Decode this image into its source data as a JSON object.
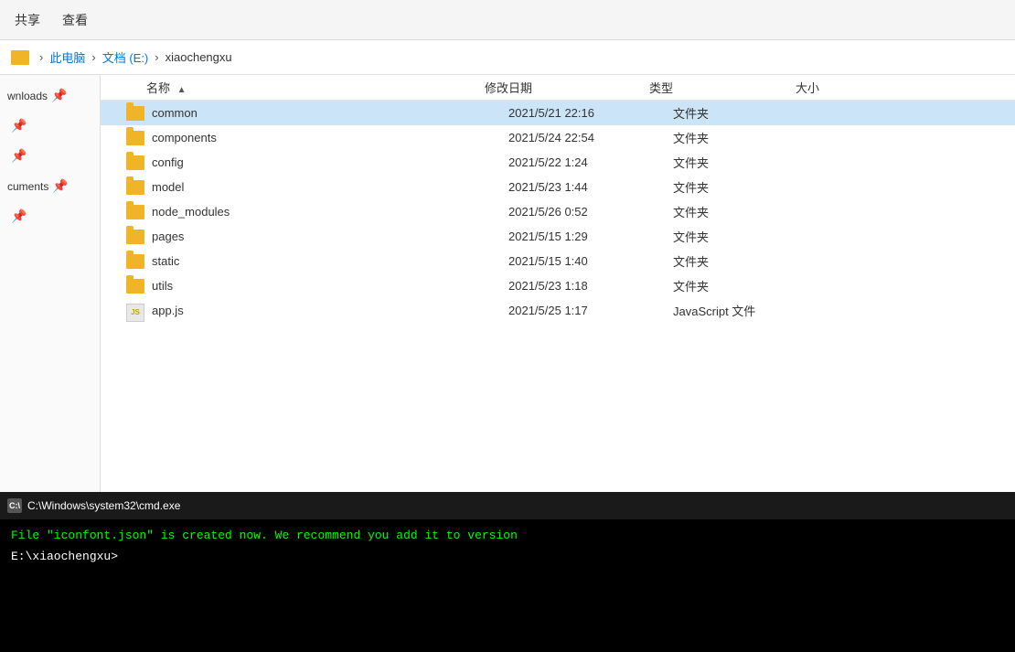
{
  "toolbar": {
    "items": [
      "共享",
      "查看"
    ]
  },
  "breadcrumb": {
    "icon_label": "folder",
    "path": [
      {
        "label": "此电脑",
        "sep": "›"
      },
      {
        "label": "文档 (E:)",
        "sep": "›"
      },
      {
        "label": "xiaochengxu",
        "sep": ""
      }
    ]
  },
  "sidebar": {
    "items": [
      {
        "label": "wnloads",
        "pin": true
      },
      {
        "label": "",
        "pin": true
      },
      {
        "label": "",
        "pin": true
      },
      {
        "label": "cuments",
        "pin": true
      },
      {
        "label": "",
        "pin": true
      }
    ]
  },
  "columns": {
    "name": "名称",
    "date": "修改日期",
    "type": "类型",
    "size": "大小"
  },
  "files": [
    {
      "name": "common",
      "date": "2021/5/21 22:16",
      "type": "文件夹",
      "size": "",
      "kind": "folder",
      "selected": true
    },
    {
      "name": "components",
      "date": "2021/5/24 22:54",
      "type": "文件夹",
      "size": "",
      "kind": "folder",
      "selected": false
    },
    {
      "name": "config",
      "date": "2021/5/22 1:24",
      "type": "文件夹",
      "size": "",
      "kind": "folder",
      "selected": false
    },
    {
      "name": "model",
      "date": "2021/5/23 1:44",
      "type": "文件夹",
      "size": "",
      "kind": "folder",
      "selected": false
    },
    {
      "name": "node_modules",
      "date": "2021/5/26 0:52",
      "type": "文件夹",
      "size": "",
      "kind": "folder",
      "selected": false
    },
    {
      "name": "pages",
      "date": "2021/5/15 1:29",
      "type": "文件夹",
      "size": "",
      "kind": "folder",
      "selected": false
    },
    {
      "name": "static",
      "date": "2021/5/15 1:40",
      "type": "文件夹",
      "size": "",
      "kind": "folder",
      "selected": false
    },
    {
      "name": "utils",
      "date": "2021/5/23 1:18",
      "type": "文件夹",
      "size": "",
      "kind": "folder",
      "selected": false
    },
    {
      "name": "app.js",
      "date": "2021/5/25 1:17",
      "type": "JavaScript 文件",
      "size": "",
      "kind": "js",
      "selected": false
    }
  ],
  "cmd": {
    "titlebar_icon": "C:\\",
    "titlebar_text": "C:\\Windows\\system32\\cmd.exe",
    "output_line": "File \"iconfont.json\" is created now. We recommend you add it to version",
    "prompt": "E:\\xiaochengxu>"
  }
}
